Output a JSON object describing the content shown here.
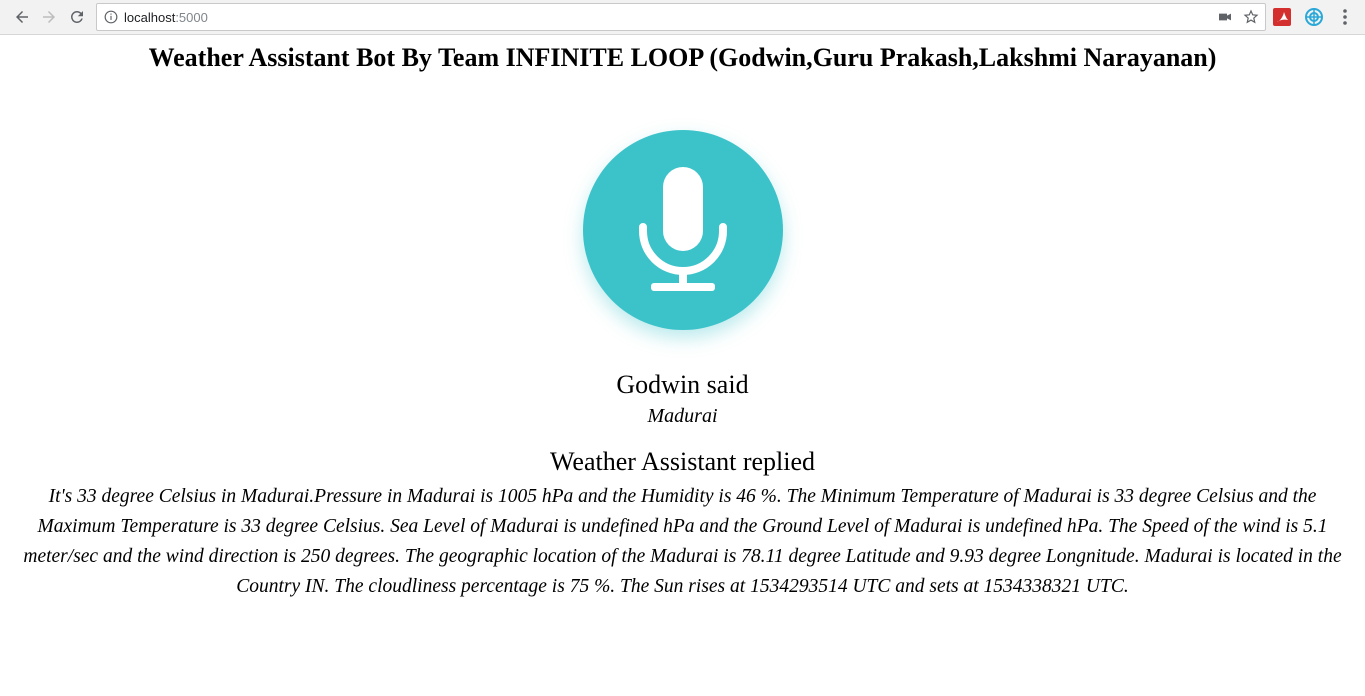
{
  "browser": {
    "url_host": "localhost",
    "url_port": ":5000"
  },
  "page": {
    "title": "Weather Assistant Bot By Team INFINITE LOOP (Godwin,Guru Prakash,Lakshmi Narayanan)",
    "user_heading": "Godwin said",
    "user_text": "Madurai",
    "bot_heading": "Weather Assistant replied",
    "bot_text": "It's 33 degree Celsius in Madurai.Pressure in Madurai is 1005 hPa and the Humidity is 46 %. The Minimum Temperature of Madurai is 33 degree Celsius and the Maximum Temperature is 33 degree Celsius. Sea Level of Madurai is undefined hPa and the Ground Level of Madurai is undefined hPa. The Speed of the wind is 5.1 meter/sec and the wind direction is 250 degrees. The geographic location of the Madurai is 78.11 degree Latitude and 9.93 degree Longnitude. Madurai is located in the Country IN. The cloudliness percentage is 75 %. The Sun rises at 1534293514 UTC and sets at 1534338321 UTC."
  },
  "colors": {
    "mic_background": "#3cc3ca",
    "mic_glyph": "#ffffff"
  },
  "icons": [
    "back-arrow-icon",
    "forward-arrow-icon",
    "reload-icon",
    "info-icon",
    "camera-icon",
    "star-icon",
    "extension-icon",
    "menu-icon",
    "microphone-icon"
  ]
}
